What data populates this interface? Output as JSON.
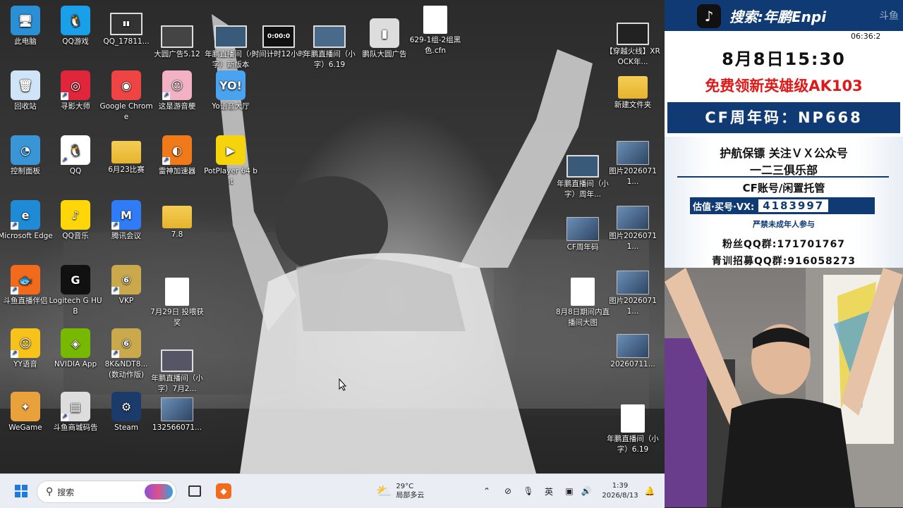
{
  "desktop": {
    "icons": [
      {
        "label": "此电脑",
        "icon": "computer-icon",
        "glyph": "🖥",
        "color": "#2b8fd6"
      },
      {
        "label": "QQ游戏",
        "icon": "qq-game-icon",
        "glyph": "🐧",
        "color": "#1aa0e8"
      },
      {
        "label": "QQ_17811...",
        "icon": "video-file-icon",
        "glyph": "▮▮",
        "color": "#333"
      },
      {
        "label": "大圆广告5.12",
        "icon": "video-file-icon",
        "glyph": "",
        "color": "#444"
      },
      {
        "label": "年鹏直播间（小字）新版本",
        "icon": "video-file-icon",
        "glyph": "",
        "color": "#3a5a7a"
      },
      {
        "label": "时间计时12小时",
        "icon": "video-file-icon",
        "glyph": "0:00:0",
        "color": "#111"
      },
      {
        "label": "年鹏直播间（小字）6.19",
        "icon": "video-file-icon",
        "glyph": "",
        "color": "#4a6a8a"
      },
      {
        "label": "鹏队大圆广告",
        "icon": "battery-file-icon",
        "glyph": "▮",
        "color": "#ddd"
      },
      {
        "label": "629-1组-2组黑色.cfn",
        "icon": "document-icon",
        "glyph": "",
        "color": "#fff"
      },
      {
        "label": "【穿越火线】XROCK年...",
        "icon": "video-file-icon",
        "glyph": "",
        "color": "#222"
      },
      {
        "label": "回收站",
        "icon": "recycle-bin-icon",
        "glyph": "🗑",
        "color": "#cfe4f7"
      },
      {
        "label": "寻影大师",
        "icon": "xunying-icon",
        "glyph": "◎",
        "color": "#e0263a"
      },
      {
        "label": "Google Chrome",
        "icon": "chrome-icon",
        "glyph": "◉",
        "color": "#e44"
      },
      {
        "label": "这是游音梗",
        "icon": "game-icon",
        "glyph": "☺",
        "color": "#f3b1c4"
      },
      {
        "label": "Yo语音大厅",
        "icon": "yo-voice-icon",
        "glyph": "YO!",
        "color": "#4aa3ee"
      },
      {
        "label": "新建文件夹",
        "icon": "folder-icon",
        "glyph": "",
        "color": "#f0c040"
      },
      {
        "label": "控制面板",
        "icon": "control-panel-icon",
        "glyph": "◔",
        "color": "#3a95d6"
      },
      {
        "label": "QQ",
        "icon": "qq-icon",
        "glyph": "🐧",
        "color": "#fff"
      },
      {
        "label": "6月23比赛",
        "icon": "folder-icon",
        "glyph": "",
        "color": "#f0c040"
      },
      {
        "label": "雷神加速器",
        "icon": "leishen-icon",
        "glyph": "◐",
        "color": "#f07a1a"
      },
      {
        "label": "PotPlayer 64 bit",
        "icon": "potplayer-icon",
        "glyph": "▶",
        "color": "#f5d40e"
      },
      {
        "label": "年鹏直播间（小字）周年...",
        "icon": "video-file-icon",
        "glyph": "",
        "color": "#3a5a7a"
      },
      {
        "label": "图片20260711...",
        "icon": "image-file-icon",
        "glyph": "",
        "color": "#667"
      },
      {
        "label": "Microsoft Edge",
        "icon": "edge-icon",
        "glyph": "e",
        "color": "#1f8ad6"
      },
      {
        "label": "QQ音乐",
        "icon": "qq-music-icon",
        "glyph": "♪",
        "color": "#ffd60a"
      },
      {
        "label": "腾讯会议",
        "icon": "tencent-meeting-icon",
        "glyph": "M",
        "color": "#2f7cf6"
      },
      {
        "label": "7.8",
        "icon": "folder-icon",
        "glyph": "",
        "color": "#f0c040"
      },
      {
        "label": "CF周年码",
        "icon": "image-file-icon",
        "glyph": "",
        "color": "#445"
      },
      {
        "label": "图片20260711...",
        "icon": "image-file-icon",
        "glyph": "",
        "color": "#678"
      },
      {
        "label": "斗鱼直播伴侣",
        "icon": "douyu-icon",
        "glyph": "🐟",
        "color": "#f26a1b"
      },
      {
        "label": "Logitech G HUB",
        "icon": "logitech-icon",
        "glyph": "G",
        "color": "#111"
      },
      {
        "label": "VKP",
        "icon": "vkp-icon",
        "glyph": "⑥",
        "color": "#c9a94c"
      },
      {
        "label": "7月29日 投喂获奖",
        "icon": "document-icon",
        "glyph": "",
        "color": "#eee"
      },
      {
        "label": "8月8日期间内直播间大图",
        "icon": "document-icon",
        "glyph": "",
        "color": "#eee"
      },
      {
        "label": "图片20260711...",
        "icon": "image-file-icon",
        "glyph": "",
        "color": "#556"
      },
      {
        "label": "YY语音",
        "icon": "yy-icon",
        "glyph": "☺",
        "color": "#f7c21a"
      },
      {
        "label": "NVIDIA App",
        "icon": "nvidia-icon",
        "glyph": "◈",
        "color": "#76b900"
      },
      {
        "label": "8K&NDT8... (数动作版)",
        "icon": "vkp-icon",
        "glyph": "⑥",
        "color": "#c9a94c"
      },
      {
        "label": "年鹏直播间（小字）7月2...",
        "icon": "video-file-icon",
        "glyph": "",
        "color": "#556"
      },
      {
        "label": "20260711...",
        "icon": "image-file-icon",
        "glyph": "",
        "color": "#667"
      },
      {
        "label": "WeGame",
        "icon": "wegame-icon",
        "glyph": "✦",
        "color": "#e9a23b"
      },
      {
        "label": "斗鱼商城码告",
        "icon": "qrcode-icon",
        "glyph": "▦",
        "color": "#ddd"
      },
      {
        "label": "Steam",
        "icon": "steam-icon",
        "glyph": "⚙",
        "color": "#1b3b6b"
      },
      {
        "label": "132566071...",
        "icon": "image-file-icon",
        "glyph": "",
        "color": "#222"
      },
      {
        "label": "年鹏直播间（小字）6.19",
        "icon": "document-icon",
        "glyph": "",
        "color": "#eee"
      }
    ]
  },
  "taskbar": {
    "search_placeholder": "搜索",
    "weather_temp": "29°C",
    "weather_desc": "局部多云",
    "ime": "英",
    "time": "1:39",
    "date": "2026/8/13"
  },
  "panel": {
    "header": "搜索:年鹏Enpi",
    "clock": "06:36:2",
    "date_line": "8月8日15:30",
    "promo_line": "免费领新英雄级AK103",
    "code_line": "CF周年码：NP668",
    "escort_line": "护航保镖 关注ＶＸ公众号",
    "club_line": "一二三俱乐部",
    "account_line": "CF账号/闲置托管",
    "vx_label": "估值·买号·VX:",
    "vx_number": "4183997",
    "minor_line": "严禁未成年人参与",
    "fans_line": "粉丝QQ群:171701767",
    "youth_line": "青训招募QQ群:916058273"
  }
}
